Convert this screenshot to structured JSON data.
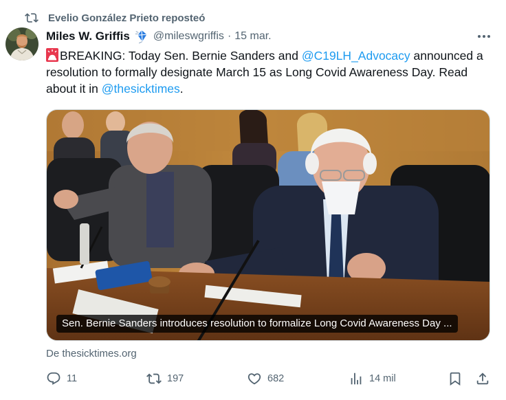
{
  "repost": {
    "text": "Evelio González Prieto reposteó",
    "icon": "repost-icon"
  },
  "author": {
    "display_name": "Miles W. Griffis",
    "badge": "kite-emoji-icon",
    "handle": "@mileswgriffis",
    "separator": "·",
    "date": "15 mar."
  },
  "body": {
    "lead_emoji": "siren-icon",
    "part1": "BREAKING: Today Sen. Bernie Sanders and ",
    "mention1": "@C19LH_Advocacy",
    "part2": " announced a resolution to formally designate March 15 as Long Covid Awareness Day. Read about it in ",
    "mention2": "@thesicktimes",
    "part3": "."
  },
  "media": {
    "caption": "Sen. Bernie Sanders introduces resolution to formalize Long Covid Awareness Day ..."
  },
  "source": "De thesicktimes.org",
  "actions": {
    "replies": "11",
    "reposts": "197",
    "likes": "682",
    "views": "14 mil"
  },
  "colors": {
    "accent": "#1d9bf0",
    "muted": "#536471",
    "text": "#0f1419"
  }
}
